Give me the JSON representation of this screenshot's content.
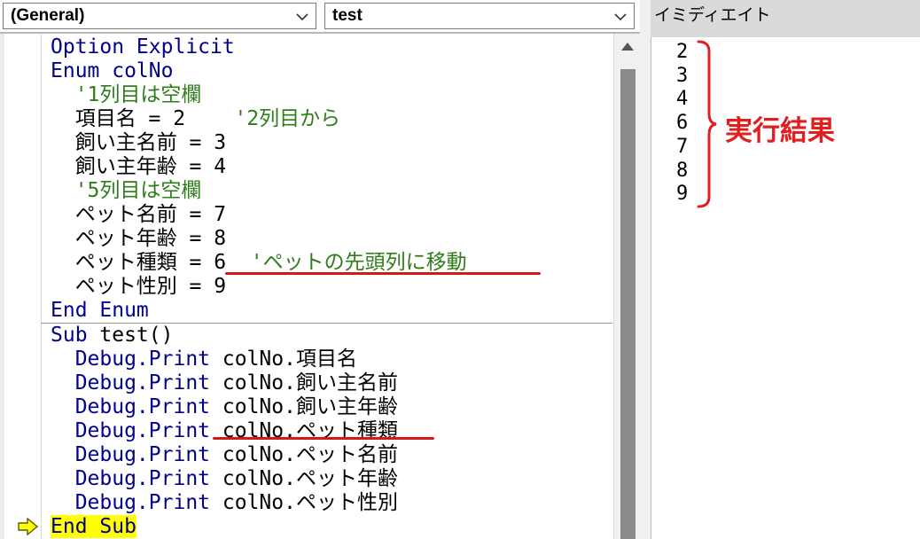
{
  "toolbar": {
    "object_combo": "(General)",
    "proc_combo": "test"
  },
  "code": {
    "declarations": [
      {
        "segments": [
          {
            "t": "Option Explicit",
            "c": "kw"
          }
        ]
      },
      {
        "segments": [
          {
            "t": "Enum colNo",
            "c": "kw"
          }
        ]
      },
      {
        "segments": [
          {
            "t": "  '1列目は空欄",
            "c": "cm"
          }
        ]
      },
      {
        "segments": [
          {
            "t": "  項目名 = 2    ",
            "c": ""
          },
          {
            "t": "'2列目から",
            "c": "cm"
          }
        ]
      },
      {
        "segments": [
          {
            "t": "  飼い主名前 = 3",
            "c": ""
          }
        ]
      },
      {
        "segments": [
          {
            "t": "  飼い主年齢 = 4",
            "c": ""
          }
        ]
      },
      {
        "segments": [
          {
            "t": "  '5列目は空欄",
            "c": "cm"
          }
        ]
      },
      {
        "segments": [
          {
            "t": "  ペット名前 = 7",
            "c": ""
          }
        ]
      },
      {
        "segments": [
          {
            "t": "  ペット年齢 = 8",
            "c": ""
          }
        ]
      },
      {
        "segments": [
          {
            "t": "  ペット種類 = 6  ",
            "c": ""
          },
          {
            "t": "'ペットの先頭列に移動",
            "c": "cm"
          }
        ]
      },
      {
        "segments": [
          {
            "t": "  ペット性別 = 9",
            "c": ""
          }
        ]
      },
      {
        "segments": [
          {
            "t": "End Enum",
            "c": "kw"
          }
        ]
      }
    ],
    "procedure": [
      {
        "segments": [
          {
            "t": "Sub ",
            "c": "kw"
          },
          {
            "t": "test()",
            "c": ""
          }
        ]
      },
      {
        "segments": [
          {
            "t": "  Debug.Print ",
            "c": "kw"
          },
          {
            "t": "colNo.項目名",
            "c": ""
          }
        ]
      },
      {
        "segments": [
          {
            "t": "  Debug.Print ",
            "c": "kw"
          },
          {
            "t": "colNo.飼い主名前",
            "c": ""
          }
        ]
      },
      {
        "segments": [
          {
            "t": "  Debug.Print ",
            "c": "kw"
          },
          {
            "t": "colNo.飼い主年齢",
            "c": ""
          }
        ]
      },
      {
        "segments": [
          {
            "t": "  Debug.Print ",
            "c": "kw"
          },
          {
            "t": "colNo.ペット種類",
            "c": ""
          }
        ]
      },
      {
        "segments": [
          {
            "t": "  Debug.Print ",
            "c": "kw"
          },
          {
            "t": "colNo.ペット名前",
            "c": ""
          }
        ]
      },
      {
        "segments": [
          {
            "t": "  Debug.Print ",
            "c": "kw"
          },
          {
            "t": "colNo.ペット年齢",
            "c": ""
          }
        ]
      },
      {
        "segments": [
          {
            "t": "  Debug.Print ",
            "c": "kw"
          },
          {
            "t": "colNo.ペット性別",
            "c": ""
          }
        ]
      },
      {
        "segments": [
          {
            "t": "End Sub",
            "c": "kw hl"
          }
        ]
      }
    ]
  },
  "immediate": {
    "title": "イミディエイト",
    "values": [
      "2",
      "3",
      "4",
      "6",
      "7",
      "8",
      "9"
    ],
    "annotation": "実行結果"
  },
  "colors": {
    "keyword": "#00008b",
    "comment": "#2e7d1a",
    "annotation_red": "#e02020",
    "execution_highlight": "#ffff00"
  },
  "icons": {
    "execution_pointer": "yellow-arrow-icon",
    "combo_dropdown": "chevron-down-icon"
  }
}
